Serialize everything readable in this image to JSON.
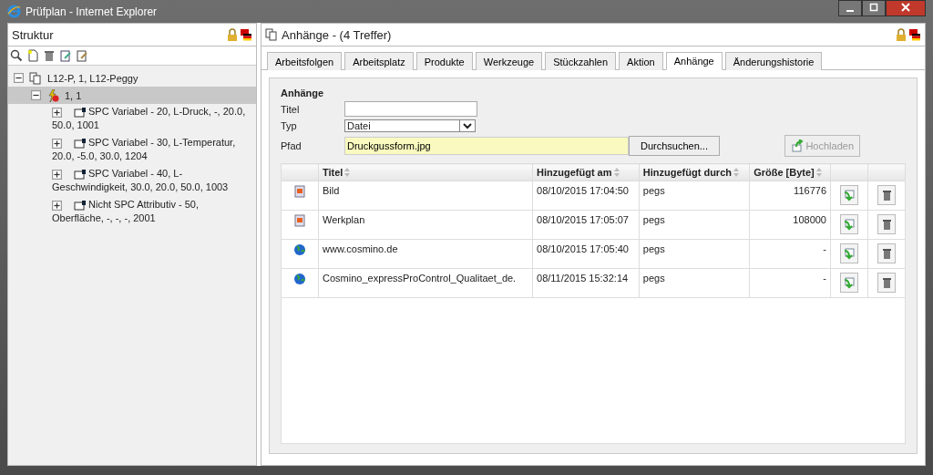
{
  "window": {
    "title": "Prüfplan - Internet Explorer"
  },
  "sidebar": {
    "title": "Struktur",
    "tree": [
      {
        "label": "L12-P, 1, L12-Peggy",
        "expanded": true,
        "selected": false,
        "kind": "plan",
        "children": [
          {
            "label": "1, 1",
            "expanded": true,
            "selected": true,
            "kind": "step",
            "children": [
              {
                "label": "SPC Variabel - 20, L-Druck, -, 20.0, 50.0, 1001",
                "expanded": false,
                "selected": false,
                "kind": "feature"
              },
              {
                "label": "SPC Variabel - 30, L-Temperatur, 20.0, -5.0, 30.0, 1204",
                "expanded": false,
                "selected": false,
                "kind": "feature"
              },
              {
                "label": "SPC Variabel - 40, L-Geschwindigkeit, 30.0, 20.0, 50.0, 1003",
                "expanded": false,
                "selected": false,
                "kind": "feature"
              },
              {
                "label": "Nicht SPC Attributiv - 50, Oberfläche, -, -, -, 2001",
                "expanded": false,
                "selected": false,
                "kind": "feature"
              }
            ]
          }
        ]
      }
    ]
  },
  "main": {
    "title": "Anhänge - (4 Treffer)",
    "tabs": [
      {
        "label": "Arbeitsfolgen",
        "selected": false
      },
      {
        "label": "Arbeitsplatz",
        "selected": false
      },
      {
        "label": "Produkte",
        "selected": false
      },
      {
        "label": "Werkzeuge",
        "selected": false
      },
      {
        "label": "Stückzahlen",
        "selected": false
      },
      {
        "label": "Aktion",
        "selected": false
      },
      {
        "label": "Anhänge",
        "selected": true
      },
      {
        "label": "Änderungshistorie",
        "selected": false
      }
    ],
    "form": {
      "heading": "Anhänge",
      "titel_label": "Titel",
      "typ_label": "Typ",
      "typ_value": "Datei",
      "pfad_label": "Pfad",
      "pfad_value": "Druckgussform.jpg",
      "browse_button": "Durchsuchen...",
      "upload_button": {
        "label": "Hochladen",
        "disabled": true
      }
    },
    "table": {
      "columns": [
        "Titel",
        "Hinzugefügt am",
        "Hinzugefügt durch",
        "Größe [Byte]"
      ],
      "rows": [
        {
          "kind": "image",
          "title": "Bild",
          "date": "08/10/2015 17:04:50",
          "by": "pegs",
          "size": "116776"
        },
        {
          "kind": "image",
          "title": "Werkplan",
          "date": "08/10/2015 17:05:07",
          "by": "pegs",
          "size": "108000"
        },
        {
          "kind": "link",
          "title": "www.cosmino.de",
          "date": "08/10/2015 17:05:40",
          "by": "pegs",
          "size": "-"
        },
        {
          "kind": "link",
          "title": "Cosmino_expressProControl_Qualitaet_de.",
          "date": "08/11/2015 15:32:14",
          "by": "pegs",
          "size": "-"
        }
      ]
    }
  }
}
